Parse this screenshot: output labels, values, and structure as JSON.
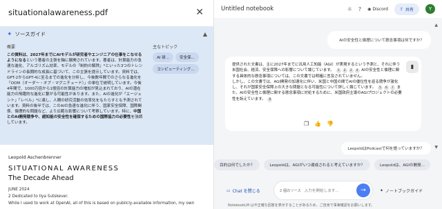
{
  "source_panel": {
    "title": "situationalawareness.pdf",
    "close_icon": "close-icon",
    "guide": {
      "title": "ソースガイド",
      "summary_label": "概要",
      "summary_bold_1": "この資料は、2027年までにAIモデルが研究者やエンジニアの仕事をこなせるようになる",
      "summary_text": "という著者の主張を軸に展開されています。著者は、計算能力の急速な進化、アルゴリズム効率、モデルの「制約の解除」*といった3つのトレンドラインの長期的な成長に基づいて、この主張を提示しています。資料では、GPT-2からGPT-4に至るまでの進化を分析し、今後数年間でのさらなる進化を「OOM（オーダー・オブ・マグニチュード）」の単位で説明しています。今後4年間で、1000万倍から1億倍の計算能力の増加が見込まれており、AIの潜在能力の飛躍的な進化に繋がる可能性があります。また、AIの進化が「エージェント」「レベル」*に達し、人間の研究活動の効率化をもたらすとも予測されています。資料の後半では、このAIの急速な進化に伴う、国家安全保障、国際関係、倫理的な問題など、より広範な影響について考察しています。特に、",
      "summary_bold_2": "中国とのAI開発競争や、超知能の安全性を確保するための国際協力の必要性",
      "summary_tail": "を強調しています。",
      "topics_label": "主なトピック",
      "topics": [
        "AI 研...",
        "安全保...",
        "コンピューティング..."
      ]
    },
    "doc": {
      "author": "Leopold Aschenbrenner",
      "title": "SITUATIONAL AWARENESS",
      "subtitle": "The Decade Ahead",
      "date": "JUNE 2024",
      "dedication": "2 Dedicated to Ilya Sutskever.",
      "intro": "While I used to work at OpenAI, all of this is based on publicly-available information, my own"
    }
  },
  "notebook": {
    "title": "Untitled notebook",
    "discord_label": "Discord",
    "share_label": "共有",
    "avatar_initial": "Y",
    "question": "AIの安全性と倫理について懸念事項は何ですか？",
    "answer_p1": "提供された文書は、主に2027年までに汎用人工知能（AGI）が実現するという予測と、それに伴う米国社会、経済、安全保障への影響について論じています。",
    "answer_p1b": "AIの安全性と倫理に関する具体的な懸念事項については、この文書では明確に言及されていません。",
    "answer_p2": "しかし、この文書では、AGI開発の加速化に伴い、米国と中国の間でAIの優位性を巡る競争が激化し、それが国家安全保障上の大きな問題となる可能性について詳しく論じています。",
    "answer_p2b": "また、AIの安全性と倫理に関する懸念事項に対処するために、米国政府主導のAGIプロジェクトの必要性を訴えています。",
    "cites": [
      "1",
      "2",
      "3",
      "4",
      "5",
      "6",
      "7",
      "8"
    ],
    "question2": "LeopoldはPodcastで何を語っていますか？",
    "suggestions": [
      "目的は何でしたか？",
      "Leopoldは、AGIがいつ達成されると考えていますか？",
      "Leopoldは、AGIの開発..."
    ],
    "chat_toggle": "Chat を閉じる",
    "source_count": "2 個のソース",
    "input_placeholder": "入力を開始します...",
    "notebook_guide": "ノートブックガイド",
    "disclaimer": "NotebookLM は不正確な回答を表示することがあるため、ご自身で事実確認をお願いします。"
  }
}
